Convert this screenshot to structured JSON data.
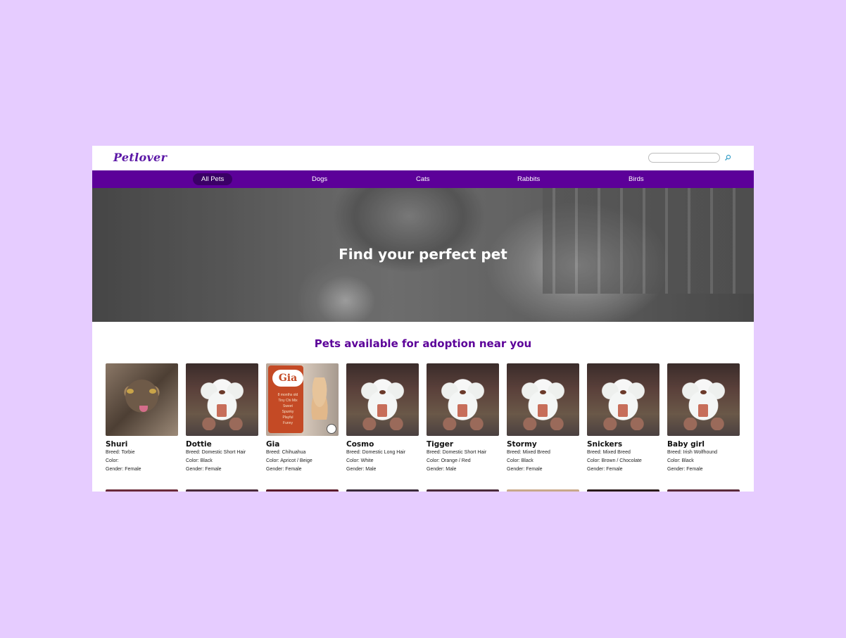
{
  "site": {
    "logo": "Petlover"
  },
  "search": {
    "placeholder": "",
    "icon": "search-icon"
  },
  "nav": {
    "items": [
      {
        "label": "All Pets",
        "active": true
      },
      {
        "label": "Dogs",
        "active": false
      },
      {
        "label": "Cats",
        "active": false
      },
      {
        "label": "Rabbits",
        "active": false
      },
      {
        "label": "Birds",
        "active": false
      }
    ]
  },
  "hero": {
    "title": "Find your perfect pet"
  },
  "section": {
    "title": "Pets available for adoption near you"
  },
  "gia_sign": {
    "heading": "Gia",
    "lines": [
      "8 months old",
      "Tiny Chi Mix",
      "Sweet",
      "Spunky",
      "Playful",
      "Funny"
    ]
  },
  "pets": [
    {
      "name": "Shuri",
      "breed": "Breed: Torbie",
      "color": "Color:",
      "gender": "Gender: Female",
      "photo": "cat"
    },
    {
      "name": "Dottie",
      "breed": "Breed: Domestic Short Hair",
      "color": "Color: Black",
      "gender": "Gender: Female",
      "photo": "teddy"
    },
    {
      "name": "Gia",
      "breed": "Breed: Chihuahua",
      "color": "Color: Apricot / Beige",
      "gender": "Gender: Female",
      "photo": "gia"
    },
    {
      "name": "Cosmo",
      "breed": "Breed: Domestic Long Hair",
      "color": "Color: White",
      "gender": "Gender: Male",
      "photo": "teddy"
    },
    {
      "name": "Tigger",
      "breed": "Breed: Domestic Short Hair",
      "color": "Color: Orange / Red",
      "gender": "Gender: Male",
      "photo": "teddy"
    },
    {
      "name": "Stormy",
      "breed": "Breed: Mixed Breed",
      "color": "Color: Black",
      "gender": "Gender: Female",
      "photo": "teddy"
    },
    {
      "name": "Snickers",
      "breed": "Breed: Mixed Breed",
      "color": "Color: Brown / Chocolate",
      "gender": "Gender: Female",
      "photo": "teddy"
    },
    {
      "name": "Baby girl",
      "breed": "Breed: Irish Wolfhound",
      "color": "Color: Black",
      "gender": "Gender: Female",
      "photo": "teddy"
    }
  ],
  "colors": {
    "brand": "#5c0099",
    "nav_active": "#3a0066",
    "page_bg": "#e6ccff"
  }
}
